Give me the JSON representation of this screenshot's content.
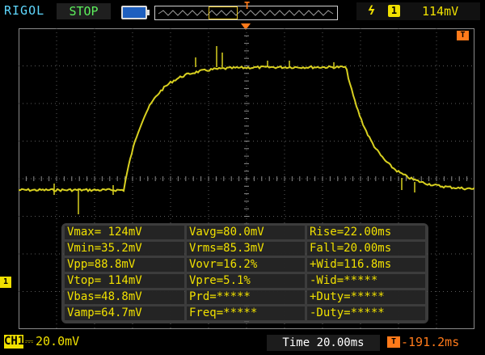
{
  "header": {
    "brand": "RIGOL",
    "run_status": "STOP",
    "trigger_marker_letter": "T",
    "trigger_slope_symbol": "ϟ",
    "trigger_source": "1",
    "trigger_level": "114mV"
  },
  "colors": {
    "background": "#000000",
    "channel1": "#f0e000",
    "trigger_orange": "#ff7a1a",
    "brand_cyan": "#5fd8ff",
    "stop_green": "#5cf05c"
  },
  "markers": {
    "timebase_position": "T",
    "channel1_ground": "1"
  },
  "measurements": [
    [
      "Vmax= 124mV",
      "Vavg=80.0mV",
      "Rise=22.00ms"
    ],
    [
      "Vmin=35.2mV",
      "Vrms=85.3mV",
      "Fall=20.00ms"
    ],
    [
      "Vpp=88.8mV",
      "Vovr=16.2%",
      "+Wid=116.8ms"
    ],
    [
      "Vtop= 114mV",
      "Vpre=5.1%",
      "-Wid=*****"
    ],
    [
      "Vbas=48.8mV",
      "Prd=*****",
      "+Duty=*****"
    ],
    [
      "Vamp=64.7mV",
      "Freq=*****",
      "-Duty=*****"
    ]
  ],
  "footer": {
    "channel_label": "CH1",
    "channel_scale": "20.0mV",
    "timebase": "Time 20.00ms",
    "trigger_offset_icon": "T",
    "trigger_offset": "-191.2ms"
  }
}
